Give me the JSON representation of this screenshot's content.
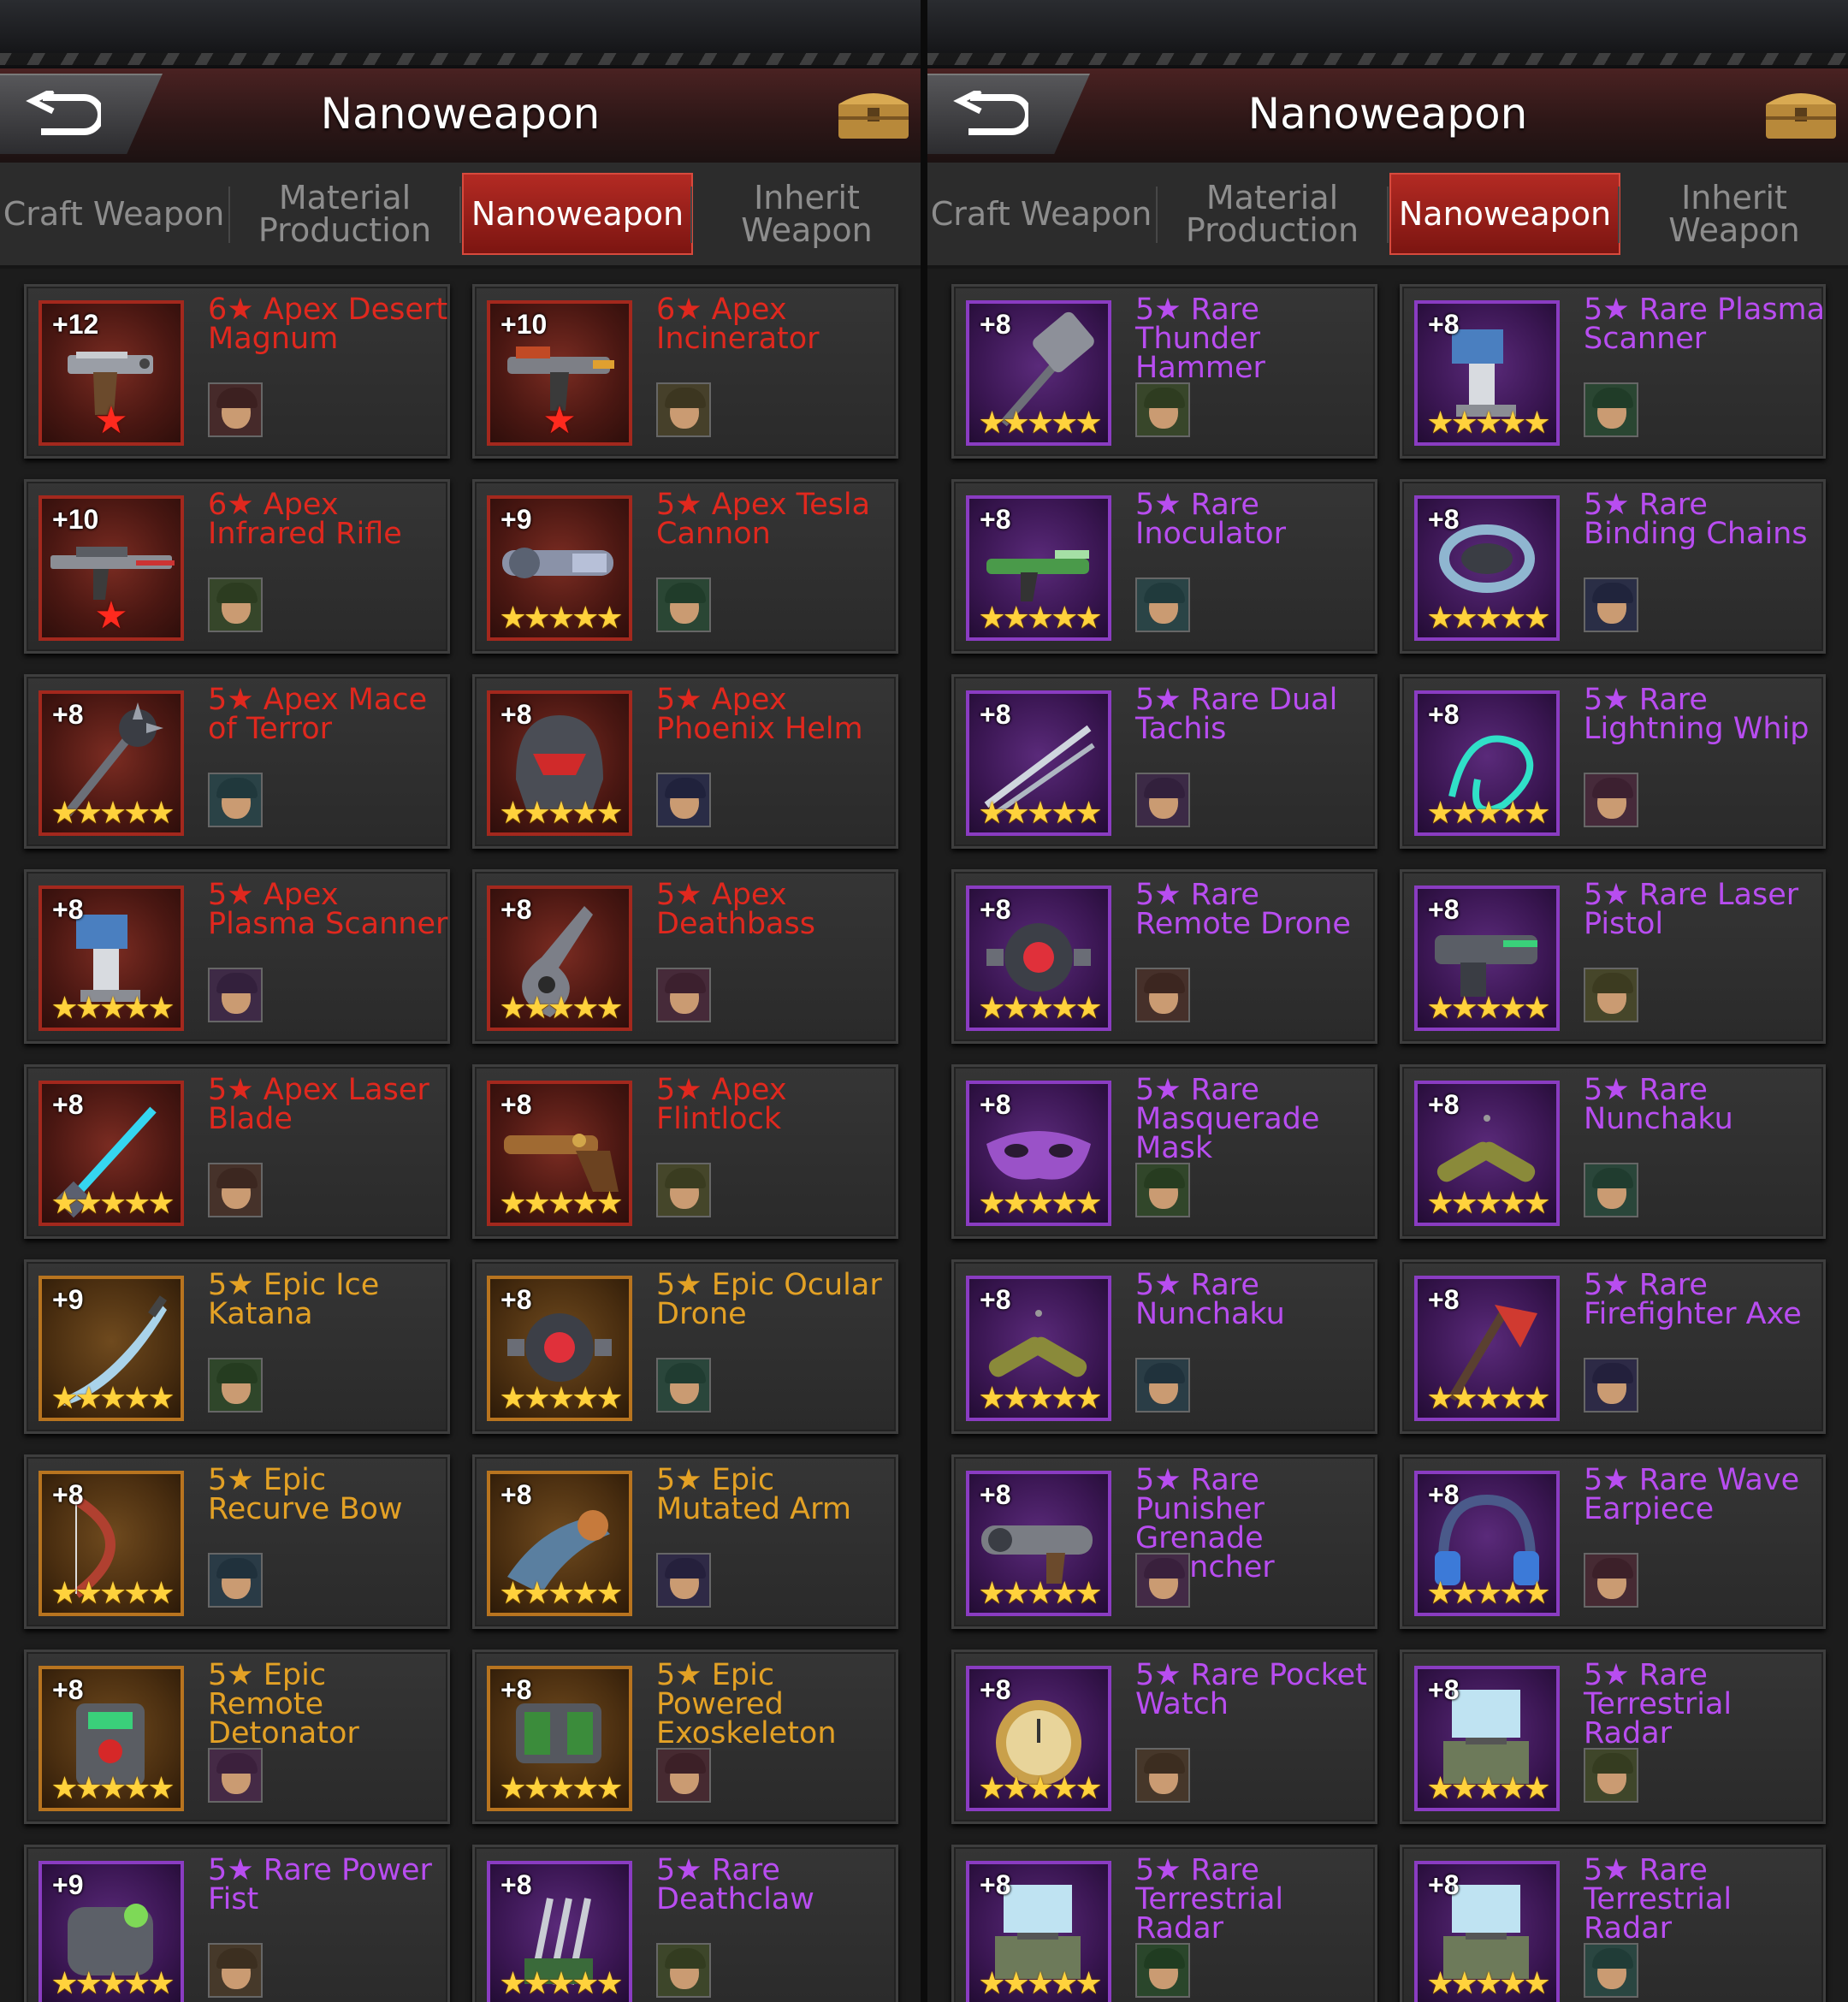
{
  "colors": {
    "apex": "#e0281e",
    "epic": "#e3a125",
    "rare": "#b84df0",
    "tab_active": "#b32a23"
  },
  "panels": [
    {
      "header": {
        "title": "Nanoweapon"
      },
      "tabs": [
        "Craft Weapon",
        "Material Production",
        "Nanoweapon",
        "Inherit Weapon"
      ],
      "active_tab": "Nanoweapon",
      "items": [
        {
          "level": "+12",
          "name": "6★ Apex Desert Magnum",
          "rarity": "apex",
          "stars": "red-star",
          "icon": "pistol-icon",
          "avatar": "hero-avatar"
        },
        {
          "level": "+10",
          "name": "6★ Apex Incinerator",
          "rarity": "apex",
          "stars": "red-star",
          "icon": "flamethrower-icon",
          "avatar": "hero-avatar"
        },
        {
          "level": "+10",
          "name": "6★ Apex Infrared Rifle",
          "rarity": "apex",
          "stars": "red-star",
          "icon": "rifle-icon",
          "avatar": "hero-avatar"
        },
        {
          "level": "+9",
          "name": "5★ Apex Tesla Cannon",
          "rarity": "apex",
          "stars": "★★★★★",
          "icon": "cannon-icon",
          "avatar": "hero-avatar"
        },
        {
          "level": "+8",
          "name": "5★ Apex Mace of Terror",
          "rarity": "apex",
          "stars": "★★★★★",
          "icon": "mace-icon",
          "avatar": "hero-avatar"
        },
        {
          "level": "+8",
          "name": "5★ Apex Phoenix Helm",
          "rarity": "apex",
          "stars": "★★★★★",
          "icon": "helmet-icon",
          "avatar": "hero-avatar"
        },
        {
          "level": "+8",
          "name": "5★ Apex Plasma Scanner",
          "rarity": "apex",
          "stars": "★★★★★",
          "icon": "scanner-icon",
          "avatar": "hero-avatar"
        },
        {
          "level": "+8",
          "name": "5★ Apex Deathbass",
          "rarity": "apex",
          "stars": "★★★★★",
          "icon": "guitar-icon",
          "avatar": "hero-avatar"
        },
        {
          "level": "+8",
          "name": "5★ Apex Laser Blade",
          "rarity": "apex",
          "stars": "★★★★★",
          "icon": "laser-blade-icon",
          "avatar": "hero-avatar"
        },
        {
          "level": "+8",
          "name": "5★ Apex Flintlock",
          "rarity": "apex",
          "stars": "★★★★★",
          "icon": "flintlock-icon",
          "avatar": "hero-avatar"
        },
        {
          "level": "+9",
          "name": "5★ Epic Ice Katana",
          "rarity": "epic",
          "stars": "★★★★★",
          "icon": "katana-icon",
          "avatar": "hero-avatar"
        },
        {
          "level": "+8",
          "name": "5★ Epic Ocular Drone",
          "rarity": "epic",
          "stars": "★★★★★",
          "icon": "drone-icon",
          "avatar": "hero-avatar"
        },
        {
          "level": "+8",
          "name": "5★ Epic Recurve Bow",
          "rarity": "epic",
          "stars": "★★★★★",
          "icon": "bow-icon",
          "avatar": "hero-avatar"
        },
        {
          "level": "+8",
          "name": "5★ Epic Mutated Arm",
          "rarity": "epic",
          "stars": "★★★★★",
          "icon": "arm-icon",
          "avatar": "hero-avatar"
        },
        {
          "level": "+8",
          "name": "5★ Epic Remote Detonator",
          "rarity": "epic",
          "stars": "★★★★★",
          "icon": "detonator-icon",
          "avatar": "hero-avatar"
        },
        {
          "level": "+8",
          "name": "5★ Epic Powered Exoskeleton",
          "rarity": "epic",
          "stars": "★★★★★",
          "icon": "exoskeleton-icon",
          "avatar": "hero-avatar"
        },
        {
          "level": "+9",
          "name": "5★ Rare Power Fist",
          "rarity": "rare",
          "stars": "★★★★★",
          "icon": "fist-icon",
          "avatar": "hero-avatar"
        },
        {
          "level": "+8",
          "name": "5★ Rare Deathclaw",
          "rarity": "rare",
          "stars": "★★★★★",
          "icon": "claw-icon",
          "avatar": "hero-avatar"
        }
      ]
    },
    {
      "header": {
        "title": "Nanoweapon"
      },
      "tabs": [
        "Craft Weapon",
        "Material Production",
        "Nanoweapon",
        "Inherit Weapon"
      ],
      "active_tab": "Nanoweapon",
      "items": [
        {
          "level": "+8",
          "name": "5★ Rare Thunder Hammer",
          "rarity": "rare",
          "stars": "★★★★★",
          "icon": "hammer-icon",
          "avatar": "hero-avatar"
        },
        {
          "level": "+8",
          "name": "5★ Rare Plasma Scanner",
          "rarity": "rare",
          "stars": "★★★★★",
          "icon": "scanner-icon",
          "avatar": "hero-avatar"
        },
        {
          "level": "+8",
          "name": "5★ Rare Inoculator",
          "rarity": "rare",
          "stars": "★★★★★",
          "icon": "syringe-gun-icon",
          "avatar": "hero-avatar"
        },
        {
          "level": "+8",
          "name": "5★ Rare Binding Chains",
          "rarity": "rare",
          "stars": "★★★★★",
          "icon": "chains-icon",
          "avatar": "hero-avatar"
        },
        {
          "level": "+8",
          "name": "5★ Rare Dual Tachis",
          "rarity": "rare",
          "stars": "★★★★★",
          "icon": "swords-icon",
          "avatar": "hero-avatar"
        },
        {
          "level": "+8",
          "name": "5★ Rare Lightning Whip",
          "rarity": "rare",
          "stars": "★★★★★",
          "icon": "whip-icon",
          "avatar": "hero-avatar"
        },
        {
          "level": "+8",
          "name": "5★ Rare Remote Drone",
          "rarity": "rare",
          "stars": "★★★★★",
          "icon": "drone-icon",
          "avatar": "hero-avatar"
        },
        {
          "level": "+8",
          "name": "5★ Rare Laser Pistol",
          "rarity": "rare",
          "stars": "★★★★★",
          "icon": "laser-pistol-icon",
          "avatar": "hero-avatar"
        },
        {
          "level": "+8",
          "name": "5★ Rare Masquerade Mask",
          "rarity": "rare",
          "stars": "★★★★★",
          "icon": "mask-icon",
          "avatar": "hero-avatar"
        },
        {
          "level": "+8",
          "name": "5★ Rare Nunchaku",
          "rarity": "rare",
          "stars": "★★★★★",
          "icon": "nunchaku-icon",
          "avatar": "hero-avatar"
        },
        {
          "level": "+8",
          "name": "5★ Rare Nunchaku",
          "rarity": "rare",
          "stars": "★★★★★",
          "icon": "nunchaku-icon",
          "avatar": "hero-avatar"
        },
        {
          "level": "+8",
          "name": "5★ Rare Firefighter Axe",
          "rarity": "rare",
          "stars": "★★★★★",
          "icon": "axe-icon",
          "avatar": "hero-avatar"
        },
        {
          "level": "+8",
          "name": "5★ Rare Punisher Grenade Launcher",
          "rarity": "rare",
          "stars": "★★★★★",
          "icon": "grenade-launcher-icon",
          "avatar": "hero-avatar"
        },
        {
          "level": "+8",
          "name": "5★ Rare Wave Earpiece",
          "rarity": "rare",
          "stars": "★★★★★",
          "icon": "headset-icon",
          "avatar": "hero-avatar"
        },
        {
          "level": "+8",
          "name": "5★ Rare Pocket Watch",
          "rarity": "rare",
          "stars": "★★★★★",
          "icon": "pocket-watch-icon",
          "avatar": "hero-avatar"
        },
        {
          "level": "+8",
          "name": "5★ Rare Terrestrial Radar",
          "rarity": "rare",
          "stars": "★★★★★",
          "icon": "radar-icon",
          "avatar": "hero-avatar"
        },
        {
          "level": "+8",
          "name": "5★ Rare Terrestrial Radar",
          "rarity": "rare",
          "stars": "★★★★★",
          "icon": "radar-icon",
          "avatar": "hero-avatar"
        },
        {
          "level": "+8",
          "name": "5★ Rare Terrestrial Radar",
          "rarity": "rare",
          "stars": "★★★★★",
          "icon": "radar-icon",
          "avatar": "hero-avatar"
        }
      ]
    }
  ]
}
